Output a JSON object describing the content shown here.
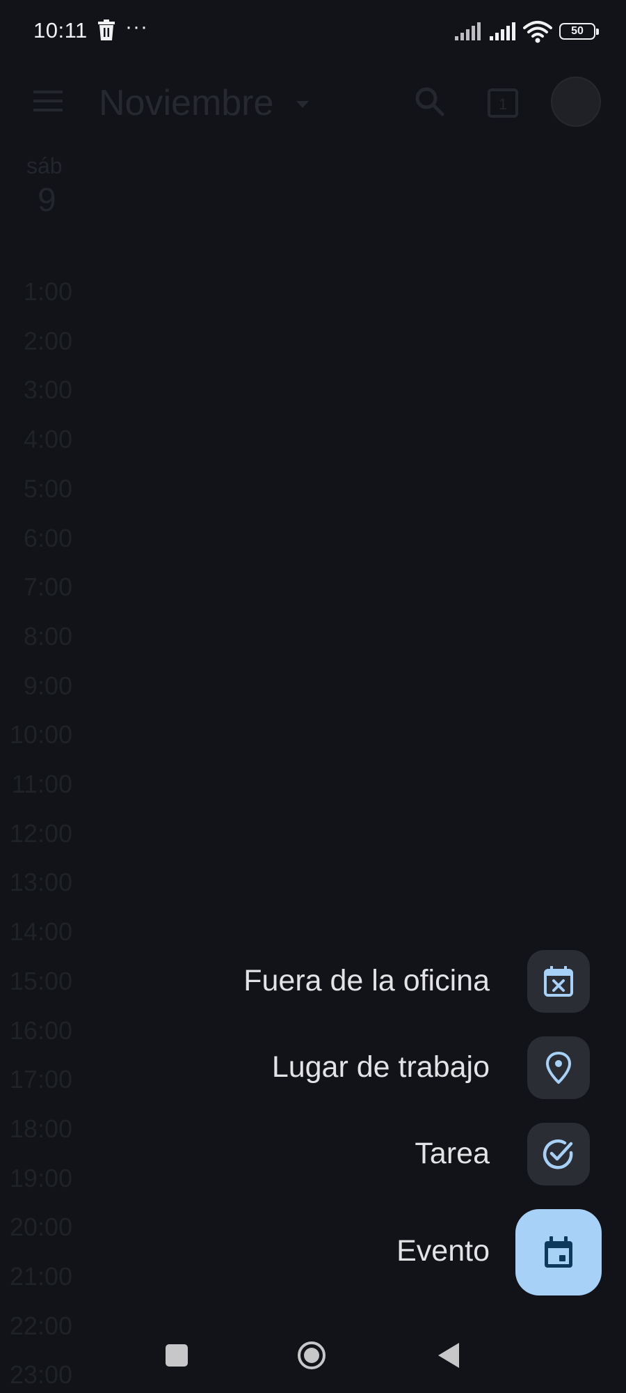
{
  "status_bar": {
    "time": "10:11",
    "more": "···",
    "battery": "50"
  },
  "calendar": {
    "month": "Noviembre",
    "day_name": "sáb",
    "day_number": "9",
    "today_badge": "1",
    "hours": [
      "1:00",
      "2:00",
      "3:00",
      "4:00",
      "5:00",
      "6:00",
      "7:00",
      "8:00",
      "9:00",
      "10:00",
      "11:00",
      "12:00",
      "13:00",
      "14:00",
      "15:00",
      "16:00",
      "17:00",
      "18:00",
      "19:00",
      "20:00",
      "21:00",
      "22:00",
      "23:00"
    ]
  },
  "speed_dial": {
    "items": [
      {
        "label": "Fuera de la oficina",
        "icon": "calendar-x-icon"
      },
      {
        "label": "Lugar de trabajo",
        "icon": "location-pin-icon"
      },
      {
        "label": "Tarea",
        "icon": "task-check-icon"
      }
    ],
    "primary": {
      "label": "Evento",
      "icon": "event-calendar-icon"
    }
  },
  "colors": {
    "background": "#111318",
    "mini_fab": "#2a2d33",
    "primary_fab": "#a8d1f8",
    "icon_accent": "#a8d1f8",
    "primary_icon": "#0d3a5c"
  }
}
